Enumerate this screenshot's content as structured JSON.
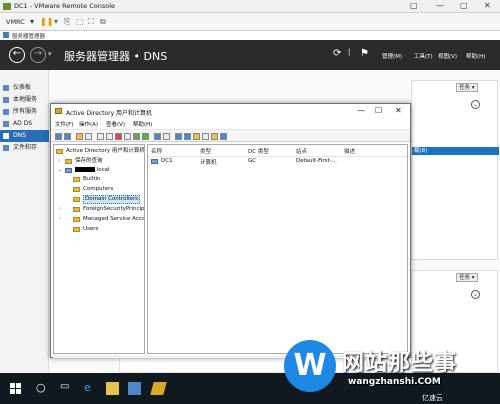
{
  "vm": {
    "title": "DC1 - VMware Remote Console",
    "toolbar_label": "VMRC",
    "controls": [
      "▢",
      "—",
      "▢",
      "✕"
    ]
  },
  "sm": {
    "window_title": "服务器管理器",
    "breadcrumb_root": "服务器管理器",
    "breadcrumb_sep": "•",
    "breadcrumb_current": "DNS",
    "menu": [
      "管理(M)",
      "工具(T)",
      "视图(V)",
      "帮助(H)"
    ],
    "sidebar": [
      "仪表板",
      "本地服务",
      "所有服务",
      "AD DS",
      "DNS",
      "文件和存"
    ],
    "task_label": "任务",
    "selected_row_text": "载(8)"
  },
  "aduc": {
    "title": "Active Directory 用户和计算机",
    "menu": [
      "文件(F)",
      "操作(A)",
      "查看(V)",
      "帮助(H)"
    ],
    "tree": {
      "root": "Active Directory 用户和计算机 [",
      "saved_queries": "保存的查询",
      "domain_suffix": ".local",
      "children": [
        "Builtin",
        "Computers",
        "Domain Controllers",
        "ForeignSecurityPrincip",
        "Managed Service Acco",
        "Users"
      ]
    },
    "list": {
      "headers": [
        "名称",
        "类型",
        "DC 类型",
        "站点",
        "描述"
      ],
      "rows": [
        {
          "name": "DC1",
          "type": "计算机",
          "dc_type": "GC",
          "site": "Default-First-..."
        }
      ]
    }
  },
  "watermark": {
    "logo": "W",
    "title": "网站那些事",
    "url": "wangzhanshi.COM",
    "sub": "亿速云"
  },
  "colors": {
    "header_bg": "#2b2b2b",
    "selection": "#1e73be",
    "taskbar": "#101820"
  }
}
